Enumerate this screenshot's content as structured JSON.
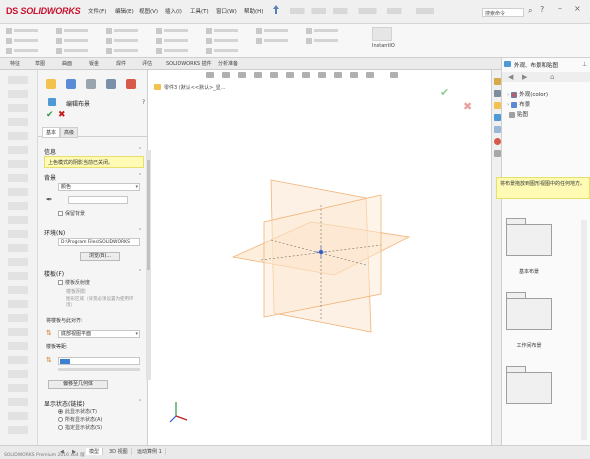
{
  "app": {
    "logo_prefix": "DS",
    "logo_text": "SOLIDWORKS",
    "menus": [
      "文件(F)",
      "编辑(E)",
      "视图(V)",
      "插入(I)",
      "工具(T)",
      "窗口(W)",
      "帮助(H)"
    ],
    "search_placeholder": "搜索命令",
    "ribbon_tool": "InstantIO"
  },
  "command_tabs": [
    "特征",
    "草图",
    "曲面",
    "钣金",
    "焊件",
    "评估",
    "SOLIDWORKS 插件",
    "分析准备"
  ],
  "property_manager": {
    "title": "编辑布景",
    "sub_tabs": [
      "基本",
      "高级"
    ],
    "message": {
      "header": "信息",
      "text": "上色模式的阴影当前已关闭。"
    },
    "background": {
      "header": "背景",
      "type_value": "颜色",
      "keep_background_label": "保留背景"
    },
    "environment": {
      "header": "环境(N)",
      "path": "D:\\Program Files\\SOLIDWORKS",
      "browse_label": "浏览(B)..."
    },
    "floor": {
      "header": "楼板(F)",
      "reflectance_label": "楼板反射度",
      "shadows_label": "楼板阴影",
      "note": "图形区域（背景必须设置为使用环境）",
      "align_label": "将楼板与此对齐:",
      "align_value": "底部视图平面",
      "offset_label": "楼板等距:",
      "offset_value": "",
      "flip_button": "偏移至几何体"
    },
    "display_state": {
      "header": "显示状态(链接)",
      "options": [
        "此显示状态(T)",
        "所有显示状态(A)",
        "指定显示状态(S)"
      ]
    }
  },
  "graphics": {
    "breadcrumb": "零件3 (默认<<默认>_显..."
  },
  "bottom_tabs": [
    "模型",
    "3D 视图",
    "运动算例 1"
  ],
  "status_text": "SOLIDWORKS Premium 2016 x64 版",
  "task_pane": {
    "title": "外观、布景和贴图",
    "tree": [
      "外观(color)",
      "布景",
      "贴图"
    ],
    "description": "将布景拖放到图形视图中的任何地方。",
    "folders": [
      "基本布景",
      "工作间布景",
      ""
    ]
  },
  "colors": {
    "accent_red": "#c8102e",
    "plane_orange": "#f0b478",
    "message_yellow": "#fffbb5",
    "ok_green": "#2e9e3e",
    "cancel_red": "#c21b1b"
  }
}
